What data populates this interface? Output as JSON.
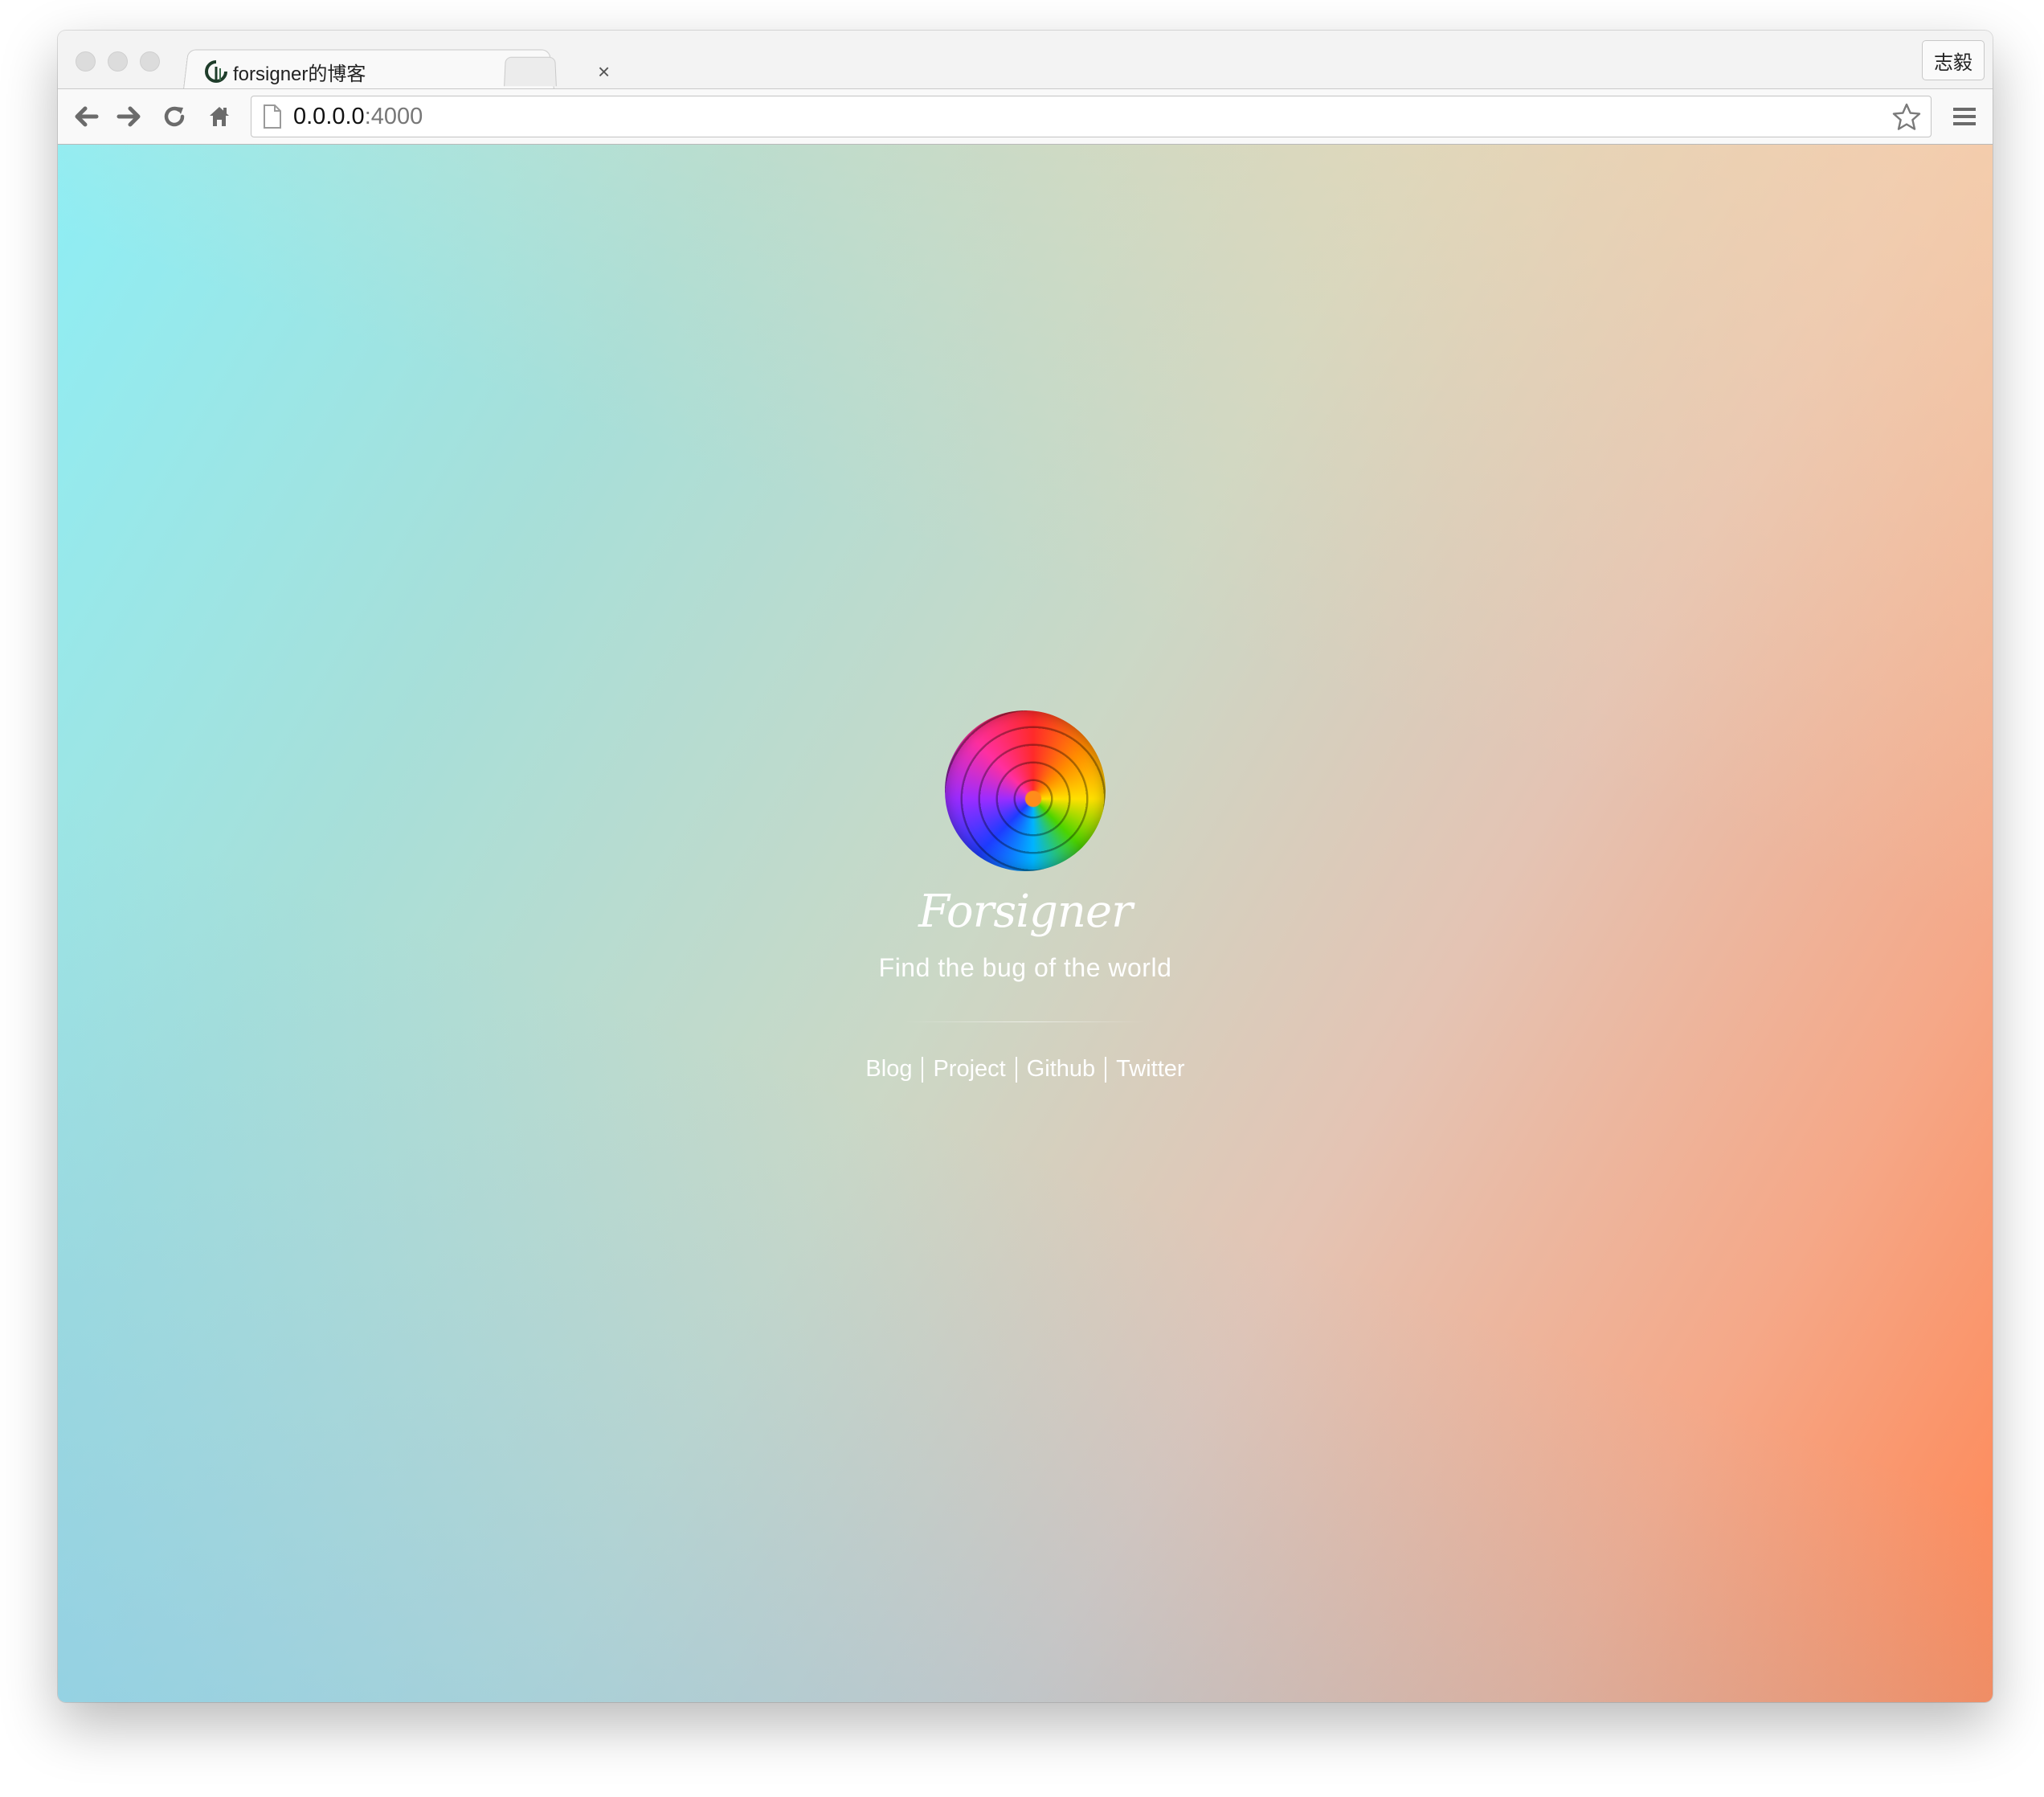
{
  "browser": {
    "tab": {
      "title": "forsigner的博客",
      "close_label": "×"
    },
    "profile_name": "志毅",
    "address": {
      "host": "0.0.0.0",
      "port": ":4000"
    }
  },
  "page": {
    "name": "Forsigner",
    "tagline": "Find the bug of the world",
    "links": [
      {
        "label": "Blog"
      },
      {
        "label": "Project"
      },
      {
        "label": "Github"
      },
      {
        "label": "Twitter"
      }
    ]
  },
  "colors": {
    "gradient_start": "#8eeef5",
    "gradient_end": "#ff8552"
  }
}
